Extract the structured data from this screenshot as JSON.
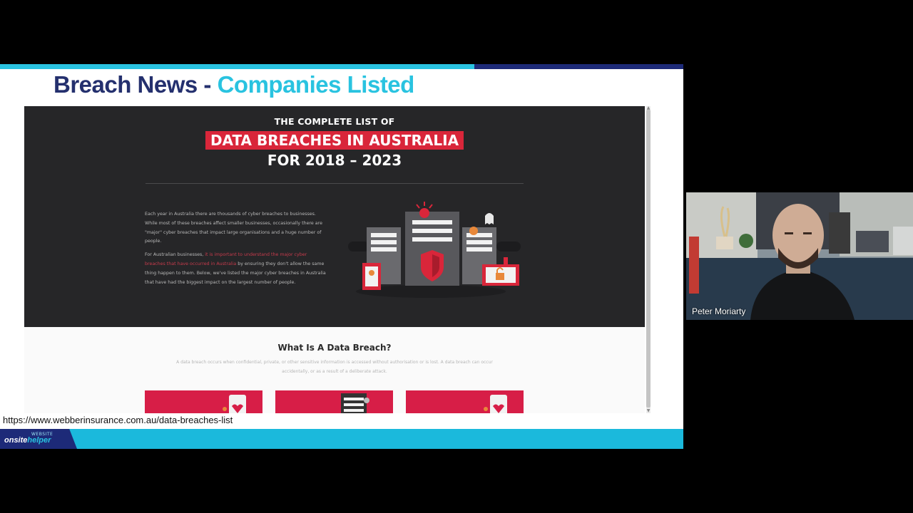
{
  "slide": {
    "title_part1": "Breach News - ",
    "title_part2": "Companies Listed"
  },
  "website": {
    "hero_pre": "THE COMPLETE LIST OF",
    "hero_main": "DATA BREACHES IN AUSTRALIA",
    "hero_sub": "FOR 2018 – 2023",
    "intro_p1": "Each year in Australia there are thousands of cyber breaches to businesses. While most of these breaches affect smaller businesses, occasionally there are \"major\" cyber breaches that impact large organisations and a huge number of people.",
    "intro_p2_start": "For Australian businesses,",
    "intro_p2_link": " it is important to understand the major cyber breaches that have occurred in Australia",
    "intro_p2_end": " by ensuring they don't allow the same thing happen to them. Below, we've listed the major cyber breaches in Australia that have had the biggest impact on the largest number of people.",
    "section_heading": "What Is A Data Breach?",
    "section_text": "A data breach occurs when confidential, private, or other sensitive information is accessed without authorisation or is lost. A data breach can occur accidentally, or as a result of a deliberate attack."
  },
  "status_url": "https://www.webberinsurance.com.au/data-breaches-list",
  "footer": {
    "logo_top": "WEBSITE",
    "logo_main_a": "onsite",
    "logo_main_b": "helper"
  },
  "video": {
    "participant_name": "Peter Moriarty"
  },
  "colors": {
    "navy": "#24306e",
    "cyan": "#29c3e0",
    "brand_red": "#d9263a",
    "dark_bg": "#262628"
  }
}
